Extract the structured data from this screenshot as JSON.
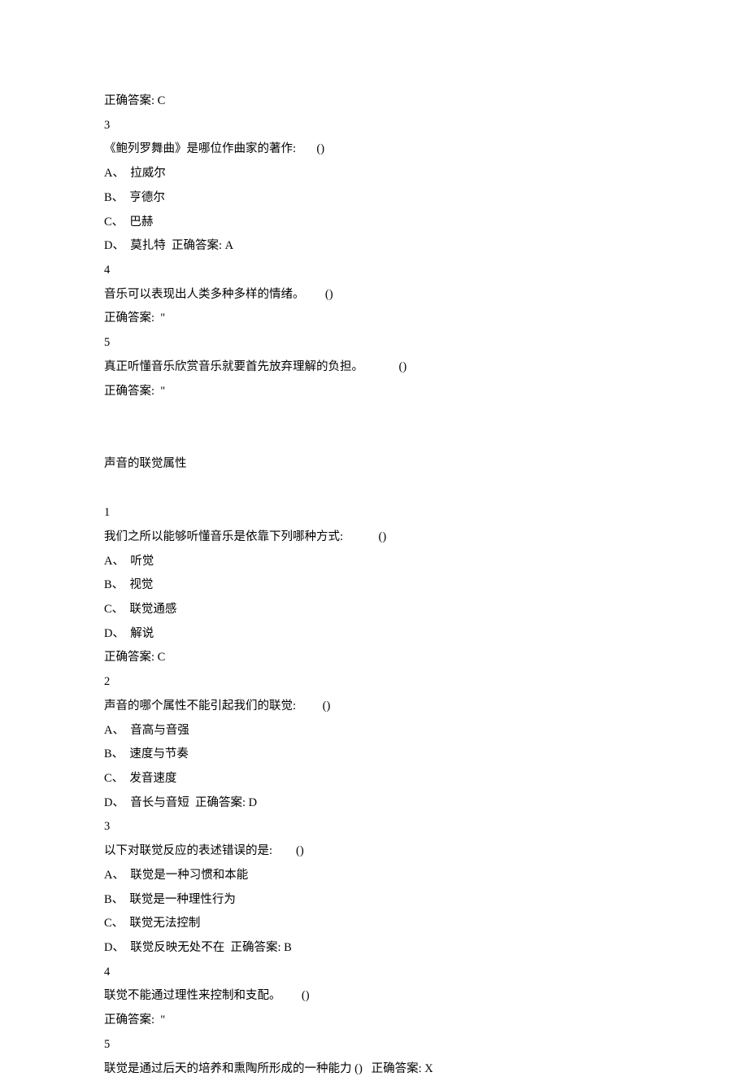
{
  "top": {
    "prev_answer": "正确答案: C",
    "q3": {
      "num": "3",
      "stem": "《鲍列罗舞曲》是哪位作曲家的著作:       ()",
      "opts": [
        "A、  拉威尔",
        "B、  亨德尔",
        "C、  巴赫",
        "D、  莫扎特  正确答案: A"
      ]
    },
    "q4": {
      "num": "4",
      "stem": "音乐可以表现出人类多种多样的情绪。       ()",
      "ans": "正确答案:  \""
    },
    "q5": {
      "num": "5",
      "stem": "真正听懂音乐欣赏音乐就要首先放弃理解的负担。            ()",
      "ans": "正确答案:  \""
    }
  },
  "section": {
    "title": "声音的联觉属性",
    "q1": {
      "num": "1",
      "stem": "我们之所以能够听懂音乐是依靠下列哪种方式:            ()",
      "opts": [
        "A、  听觉",
        "B、  视觉",
        "C、  联觉通感",
        "D、  解说"
      ],
      "ans": "正确答案: C"
    },
    "q2": {
      "num": "2",
      "stem": "声音的哪个属性不能引起我们的联觉:         ()",
      "opts": [
        "A、  音高与音强",
        "B、  速度与节奏",
        "C、  发音速度",
        "D、  音长与音短  正确答案: D"
      ]
    },
    "q3": {
      "num": "3",
      "stem": "以下对联觉反应的表述错误的是:        ()",
      "opts": [
        "A、  联觉是一种习惯和本能",
        "B、  联觉是一种理性行为",
        "C、  联觉无法控制",
        "D、  联觉反映无处不在  正确答案: B"
      ]
    },
    "q4": {
      "num": "4",
      "stem": "联觉不能通过理性来控制和支配。       ()",
      "ans": "正确答案:  \""
    },
    "q5": {
      "num": "5",
      "stem": "联觉是通过后天的培养和熏陶所形成的一种能力 ()   正确答案: X"
    }
  }
}
